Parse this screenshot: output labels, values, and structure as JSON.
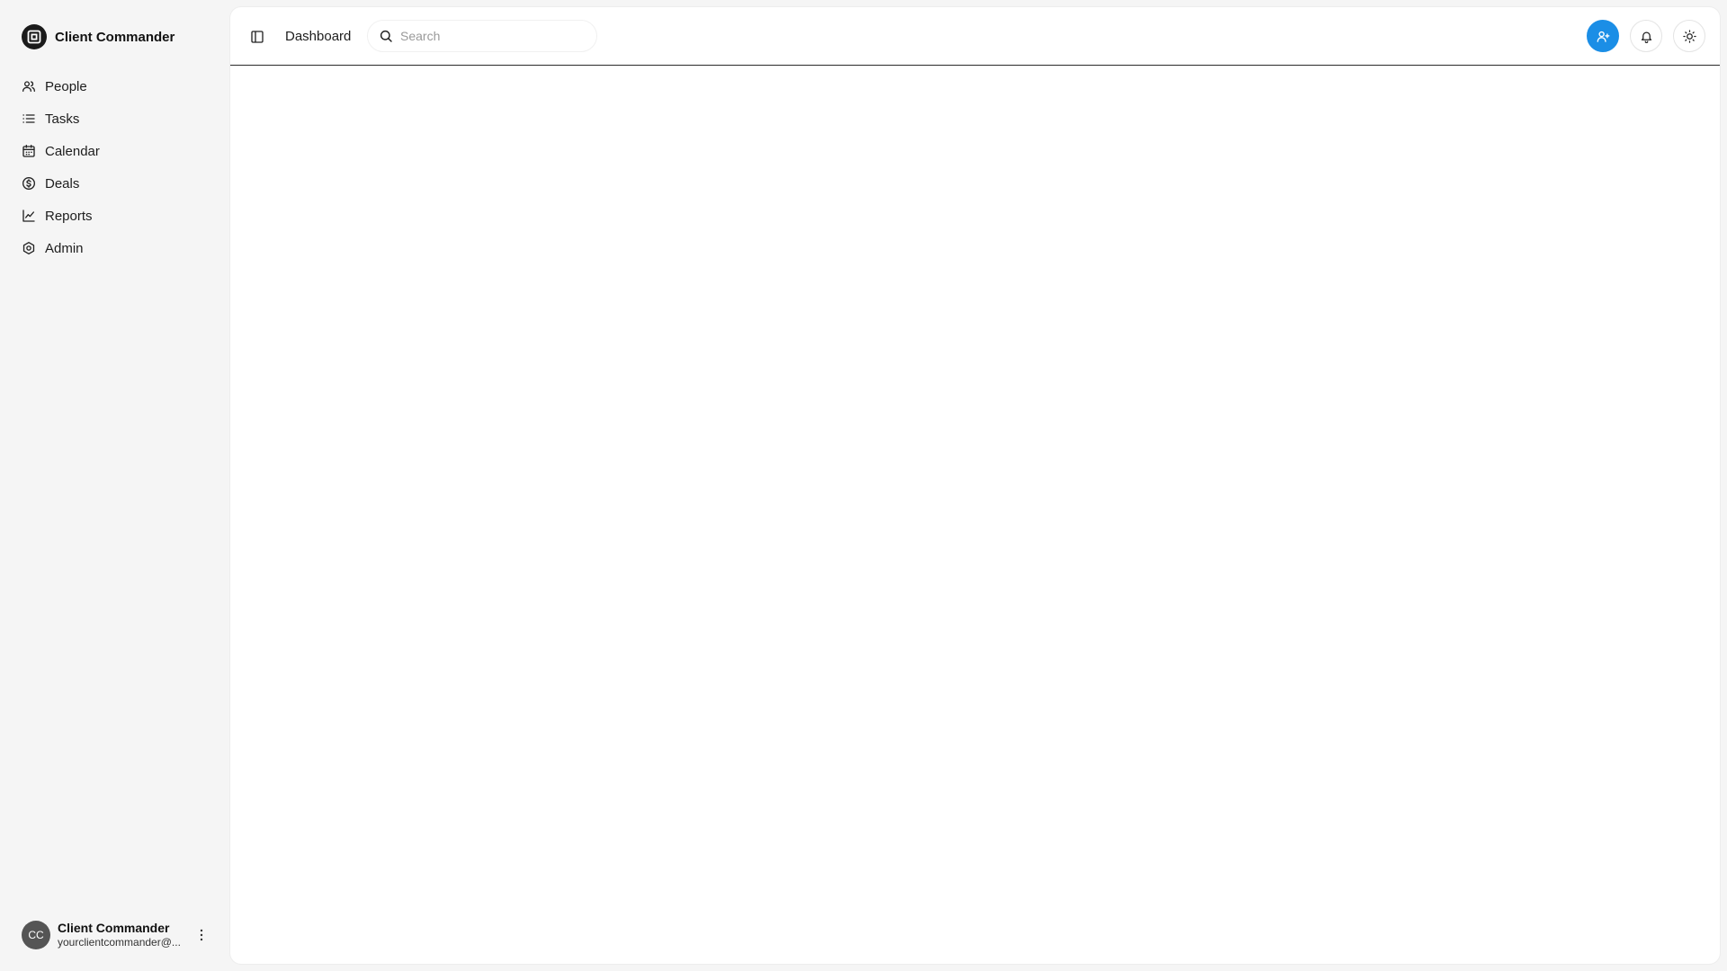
{
  "brand": {
    "name": "Client Commander"
  },
  "sidebar": {
    "items": [
      {
        "label": "People",
        "icon": "users-icon"
      },
      {
        "label": "Tasks",
        "icon": "list-icon"
      },
      {
        "label": "Calendar",
        "icon": "calendar-icon"
      },
      {
        "label": "Deals",
        "icon": "dollar-icon"
      },
      {
        "label": "Reports",
        "icon": "chart-icon"
      },
      {
        "label": "Admin",
        "icon": "settings-icon"
      }
    ]
  },
  "user": {
    "initials": "CC",
    "name": "Client Commander",
    "email": "yourclientcommander@..."
  },
  "header": {
    "title": "Dashboard",
    "search_placeholder": "Search"
  },
  "colors": {
    "accent": "#1b8ee6",
    "sidebar_bg": "#f5f5f5",
    "panel_bg": "#ffffff"
  }
}
